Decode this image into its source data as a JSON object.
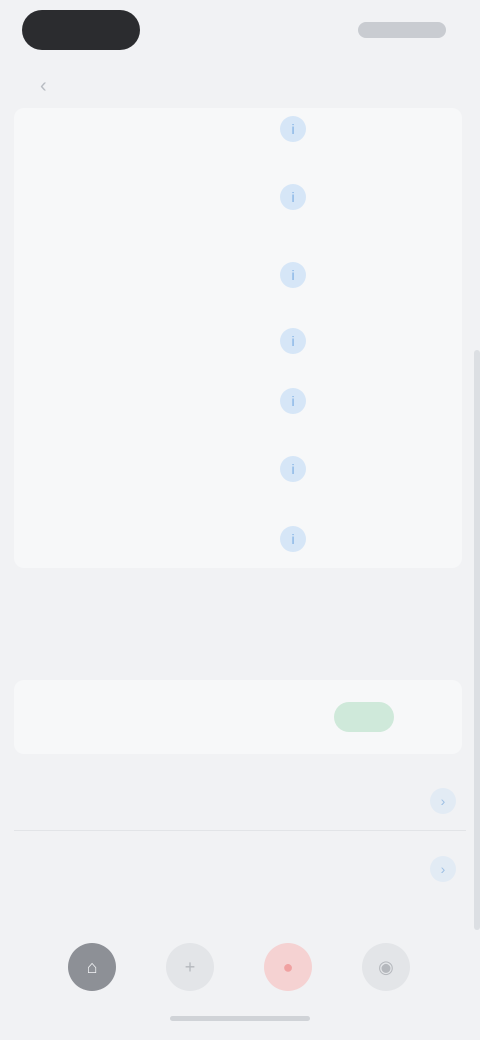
{
  "status_bar": {
    "time": "",
    "indicators": ""
  },
  "header": {
    "back_icon": "chevron-left-icon",
    "title": "",
    "action": ""
  },
  "list": {
    "rows": [
      {
        "text": "",
        "icon": "info-icon",
        "value": ""
      },
      {
        "text": "",
        "icon": "info-icon",
        "value": ""
      },
      {
        "text": "",
        "icon": "info-icon",
        "value": ""
      },
      {
        "text": "",
        "icon": "info-icon",
        "value": ""
      },
      {
        "text": "",
        "icon": "info-icon",
        "value": ""
      },
      {
        "text": "",
        "icon": "info-icon",
        "value": ""
      },
      {
        "text": "",
        "icon": "info-icon",
        "value": ""
      }
    ]
  },
  "notice": {
    "title": "",
    "text": "",
    "button_label": ""
  },
  "links": [
    {
      "label": "",
      "icon": "chevron-right-icon"
    },
    {
      "label": "",
      "icon": "chevron-right-icon"
    }
  ],
  "bottom_nav": [
    {
      "name": "nav-home",
      "icon": "home-icon",
      "color": "#8d9096"
    },
    {
      "name": "nav-add",
      "icon": "plus-icon",
      "color": "#b5b8bd"
    },
    {
      "name": "nav-record",
      "icon": "record-icon",
      "color": "#f0a1a1"
    },
    {
      "name": "nav-profile",
      "icon": "profile-icon",
      "color": "#b5b8bd"
    }
  ],
  "colors": {
    "background": "#f1f2f4",
    "card": "#f7f8f9",
    "accent_blue": "#7fb0e4",
    "accent_green": "#6bbf8d",
    "accent_red": "#f0a1a1"
  }
}
